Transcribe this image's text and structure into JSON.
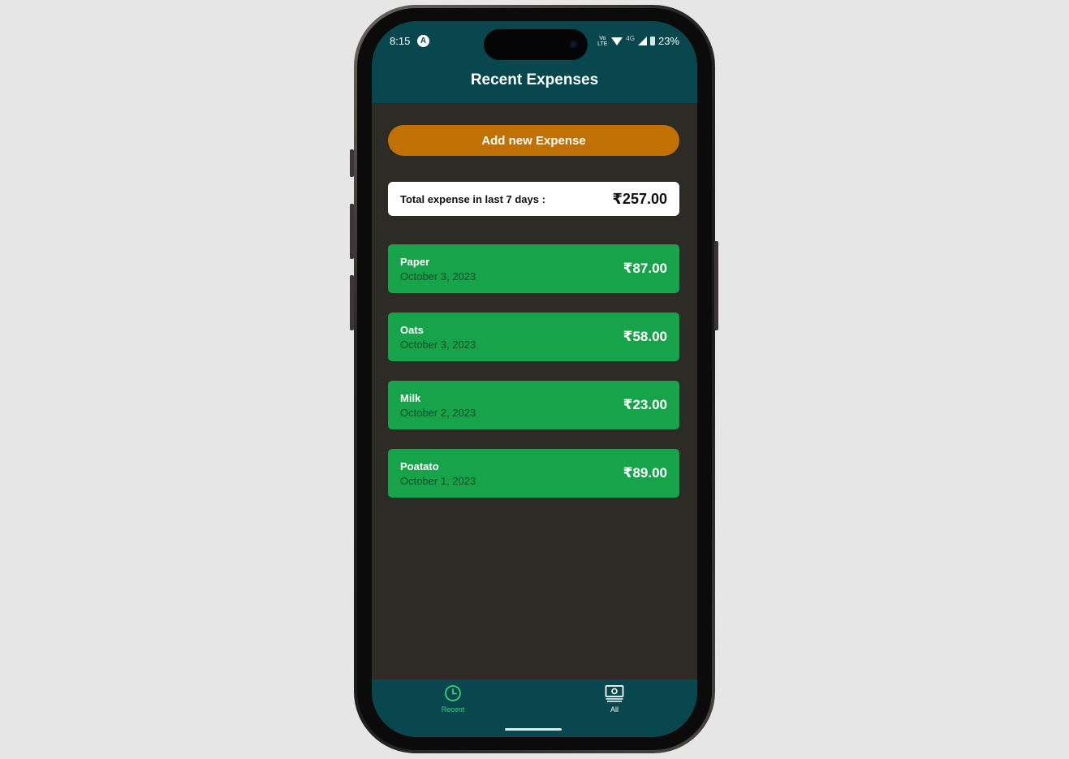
{
  "status_bar": {
    "time": "8:15",
    "app_icon_glyph": "A",
    "volte": "Vo LTE",
    "network": "4G",
    "battery": "23%"
  },
  "header": {
    "title": "Recent Expenses"
  },
  "add_button": {
    "label": "Add new Expense"
  },
  "total": {
    "label": "Total expense in last 7 days :",
    "value": "₹257.00"
  },
  "expenses": [
    {
      "title": "Paper",
      "date": "October 3, 2023",
      "amount": "₹87.00"
    },
    {
      "title": "Oats",
      "date": "October 3, 2023",
      "amount": "₹58.00"
    },
    {
      "title": "Milk",
      "date": "October 2, 2023",
      "amount": "₹23.00"
    },
    {
      "title": "Poatato",
      "date": "October 1, 2023",
      "amount": "₹89.00"
    }
  ],
  "bottom_nav": {
    "items": [
      {
        "label": "Recent",
        "icon": "clock-icon",
        "active": true
      },
      {
        "label": "All",
        "icon": "cash-icon",
        "active": false
      }
    ]
  },
  "colors": {
    "header_bg": "#07474d",
    "body_bg": "#2c2b26",
    "accent_button": "#c17003",
    "expense_card": "#17a34a",
    "active_nav": "#3ccf7f"
  }
}
